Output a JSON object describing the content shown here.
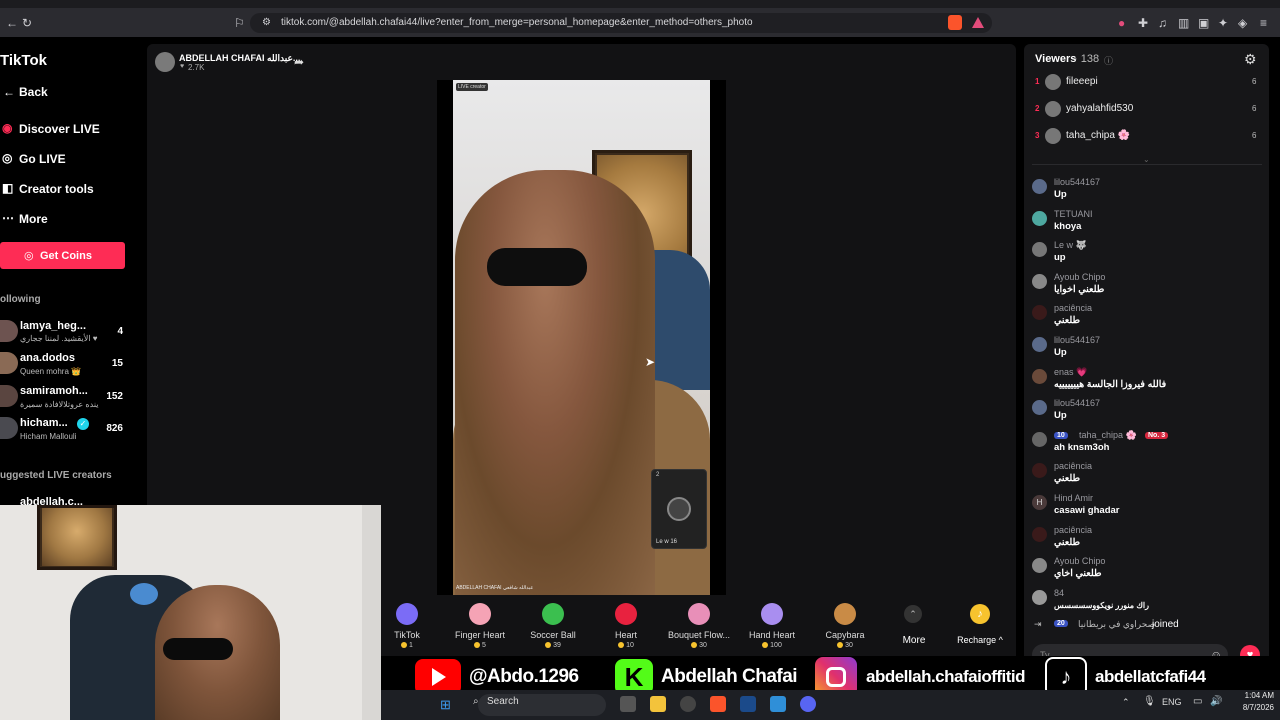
{
  "browser": {
    "url": "tiktok.com/@abdellah.chafai44/live?enter_from_merge=personal_homepage&enter_method=others_photo"
  },
  "sidebar": {
    "logo": "TikTok",
    "back": "Back",
    "nav": [
      "Discover LIVE",
      "Go LIVE",
      "Creator tools",
      "More"
    ],
    "get_coins": "Get Coins",
    "following_header": "ollowing",
    "following": [
      {
        "name": "lamya_heg...",
        "sub": "الأيقشيد. لمننا ججاري ♥",
        "count": "4"
      },
      {
        "name": "ana.dodos",
        "sub": "Queen mohra 👑",
        "count": "15"
      },
      {
        "name": "samiramoh...",
        "sub": "ينده عروتلالافادة سميرة",
        "count": "152"
      },
      {
        "name": "hicham...",
        "sub": "Hicham Mallouli",
        "count": "826"
      }
    ],
    "suggested_header": "uggested LIVE creators",
    "suggested_first": "abdellah.c..."
  },
  "host": {
    "name": "ABDELLAH CHAFAI عبدالله...",
    "likes": "2.7K"
  },
  "video": {
    "live_badge": "LIVE creator",
    "caption": "ABDELLAH CHAFAI عبدالله شافعي",
    "pip_count": "2",
    "pip_user": "Le w 16"
  },
  "gifts": [
    {
      "name": "TikTok",
      "price": "1",
      "color": "#7b6cf6"
    },
    {
      "name": "Finger Heart",
      "price": "5",
      "color": "#f5a3b5"
    },
    {
      "name": "Soccer Ball",
      "price": "39",
      "color": "#3bbf4f"
    },
    {
      "name": "Heart",
      "price": "10",
      "color": "#e8223f"
    },
    {
      "name": "Bouquet Flow...",
      "price": "30",
      "color": "#e88fb8"
    },
    {
      "name": "Hand Heart",
      "price": "100",
      "color": "#a98ef0"
    },
    {
      "name": "Capybara",
      "price": "30",
      "color": "#c98b46"
    }
  ],
  "gift_more": "More",
  "recharge": "Recharge ^",
  "viewers": {
    "title": "Viewers",
    "count": "· 138",
    "top": [
      {
        "rank": "1",
        "name": "fileeepi",
        "score": "6"
      },
      {
        "rank": "2",
        "name": "yahyalahfid530",
        "score": "6"
      },
      {
        "rank": "3",
        "name": "taha_chipa 🌸",
        "score": "6"
      }
    ]
  },
  "chat": [
    {
      "user": "lilou544167",
      "msg": "Up",
      "av": "#5a6a8a"
    },
    {
      "user": "TETUANI",
      "msg": "khoya",
      "av": "#4ea8a0"
    },
    {
      "user": "Le w 🐺",
      "msg": "up",
      "av": "#777"
    },
    {
      "user": "Ayoub Chipo",
      "msg": "طلعني اخوايا",
      "av": "#888"
    },
    {
      "user": "paciência",
      "msg": "طلعني",
      "av": "#3a1a1a"
    },
    {
      "user": "lilou544167",
      "msg": "Up",
      "av": "#5a6a8a"
    },
    {
      "user": "enas 💗",
      "msg": "فالله فيروزا الجالسة هيييييييه",
      "av": "#6a4a3a"
    },
    {
      "user": "lilou544167",
      "msg": "Up",
      "av": "#5a6a8a"
    },
    {
      "user": "taha_chipa 🌸",
      "msg": "ah knsm3oh",
      "av": "#666",
      "badge1": "10",
      "badge2": "No. 3"
    },
    {
      "user": "paciência",
      "msg": "طلعني",
      "av": "#3a1a1a"
    },
    {
      "user": "Hind Amir",
      "msg": "casawi ghadar",
      "av": "#4a3a3a",
      "initial": "H"
    },
    {
      "user": "paciência",
      "msg": "طلعني",
      "av": "#3a1a1a"
    },
    {
      "user": "Ayoub Chipo",
      "msg": "طلعني اخاي",
      "av": "#888"
    }
  ],
  "chat_tail": {
    "num": "84",
    "line": "راك منورر نويكووسسسسس"
  },
  "joined": {
    "badge": "20",
    "name": "صحراوي في بريطانيا",
    "text": "joined"
  },
  "chat_placeholder": "Ty",
  "social": {
    "youtube": "@Abdo.1296",
    "kick": "Abdellah Chafai",
    "instagram": "abdellah.chafaioffitid",
    "tiktok": "abdellatcfafi44"
  },
  "taskbar": {
    "search": "Search",
    "lang": "ENG",
    "time": "1:04 AM",
    "date": "8/7/2026"
  }
}
